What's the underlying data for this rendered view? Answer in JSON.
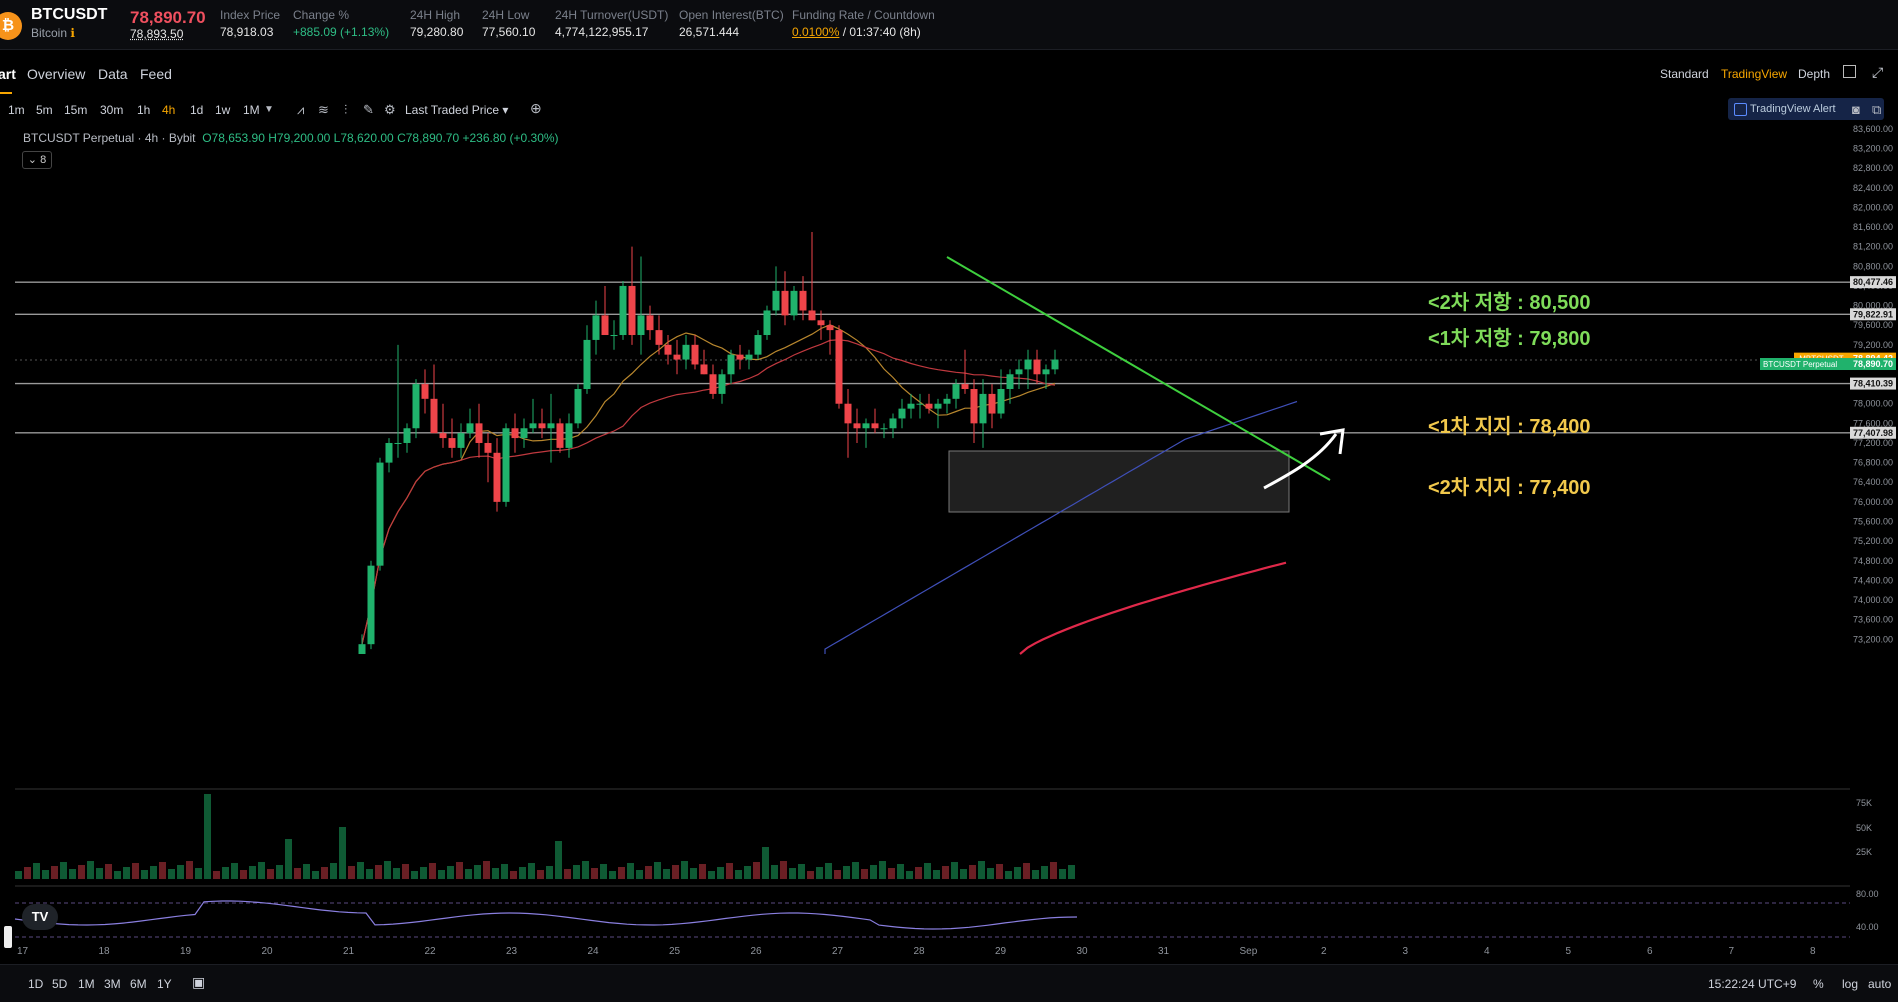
{
  "header": {
    "symbol": "BTCUSDT",
    "name": "Bitcoin",
    "last_price": "78,890.70",
    "mark_price": "78,893.50",
    "stats": [
      {
        "label": "Index Price",
        "value": "78,918.03"
      },
      {
        "label": "Change %",
        "value": "+885.09 (+1.13%)"
      },
      {
        "label": "24H High",
        "value": "79,280.80"
      },
      {
        "label": "24H Low",
        "value": "77,560.10"
      },
      {
        "label": "24H Turnover(USDT)",
        "value": "4,774,122,955.17"
      },
      {
        "label": "Open Interest(BTC)",
        "value": "26,571.444"
      },
      {
        "label": "Funding Rate / Countdown",
        "rate": "0.0100%",
        "countdown": "/ 01:37:40 (8h)"
      }
    ]
  },
  "tabs": [
    "art",
    "Overview",
    "Data",
    "Feed"
  ],
  "view_tabs": [
    "Standard",
    "TradingView",
    "Depth"
  ],
  "timeframes": [
    "1m",
    "5m",
    "15m",
    "30m",
    "1h",
    "4h",
    "1d",
    "1w",
    "1M"
  ],
  "active_timeframe": "4h",
  "price_source": "Last Traded Price",
  "tv_alert": "TradingView Alert",
  "legend": {
    "title": "BTCUSDT Perpetual · 4h · Bybit",
    "o": "O78,653.90",
    "h": "H79,200.00",
    "l": "L78,620.00",
    "c": "C78,890.70",
    "chg": "+236.80 (+0.30%)",
    "indicators_count": "8"
  },
  "annotations": [
    {
      "text": "<2차 저항 : 80,500",
      "color": "#7fdc5a"
    },
    {
      "text": "<1차 저항 : 79,800",
      "color": "#7fdc5a"
    },
    {
      "text": "<1차 지지 : 78,400",
      "color": "#f2c94c"
    },
    {
      "text": "<2차 지지 : 77,400",
      "color": "#f2c94c"
    }
  ],
  "tags": [
    {
      "text": ".MBTCUSDT",
      "value": "78,894.42"
    },
    {
      "text": "BTCUSDT Perpetual",
      "value": "78,890.70"
    }
  ],
  "bottom_ranges": [
    "1D",
    "5D",
    "1M",
    "3M",
    "6M",
    "1Y"
  ],
  "bottom_right": {
    "time": "15:22:24 UTC+9",
    "pct": "%",
    "log": "log",
    "auto": "auto"
  },
  "chart_data": {
    "type": "candlestick",
    "y_range": [
      72900,
      83700
    ],
    "price_ticks": [
      "83,600.00",
      "83,200.00",
      "82,800.00",
      "82,400.00",
      "82,000.00",
      "81,600.00",
      "81,200.00",
      "80,800.00",
      "80,400.00",
      "80,000.00",
      "79,600.00",
      "79,200.00",
      "78,800.00",
      "78,400.00",
      "78,000.00",
      "77,600.00",
      "77,200.00",
      "76,800.00",
      "76,400.00",
      "76,000.00",
      "75,600.00",
      "75,200.00",
      "74,800.00",
      "74,400.00",
      "74,000.00",
      "73,600.00",
      "73,200.00"
    ],
    "date_ticks": [
      "17",
      "18",
      "19",
      "20",
      "21",
      "22",
      "23",
      "24",
      "25",
      "26",
      "27",
      "28",
      "29",
      "30",
      "31",
      "Sep",
      "2",
      "3",
      "4",
      "5",
      "6",
      "7",
      "8"
    ],
    "hlines": [
      {
        "price": 80477.46,
        "label": "80,477.46"
      },
      {
        "price": 79822.91,
        "label": "79,822.91"
      },
      {
        "price": 78410.39,
        "label": "78,410.39"
      },
      {
        "price": 77407.98,
        "label": "77,407.98"
      }
    ],
    "volume_ticks": [
      "75K",
      "50K",
      "25K"
    ],
    "rsi_ticks": [
      "80.00",
      "40.00"
    ],
    "candles": [
      [
        72900,
        73300,
        72900,
        73100
      ],
      [
        73100,
        74800,
        73000,
        74700
      ],
      [
        74700,
        76900,
        74600,
        76800
      ],
      [
        76800,
        77300,
        76600,
        77200
      ],
      [
        77200,
        79200,
        76900,
        77200
      ],
      [
        77200,
        77600,
        77000,
        77500
      ],
      [
        77500,
        78500,
        77300,
        78400
      ],
      [
        78400,
        78700,
        77800,
        78100
      ],
      [
        78100,
        78800,
        77400,
        77400
      ],
      [
        77400,
        78000,
        77100,
        77300
      ],
      [
        77300,
        77700,
        76900,
        77100
      ],
      [
        77100,
        77600,
        76900,
        77400
      ],
      [
        77400,
        77900,
        77300,
        77600
      ],
      [
        77600,
        78000,
        76900,
        77200
      ],
      [
        77200,
        77400,
        76400,
        77000
      ],
      [
        77000,
        77300,
        75800,
        76000
      ],
      [
        76000,
        77600,
        75900,
        77500
      ],
      [
        77500,
        77800,
        77000,
        77300
      ],
      [
        77300,
        77700,
        77100,
        77500
      ],
      [
        77500,
        78100,
        77400,
        77600
      ],
      [
        77600,
        77900,
        77300,
        77500
      ],
      [
        77500,
        78200,
        76800,
        77600
      ],
      [
        77600,
        77700,
        77000,
        77100
      ],
      [
        77100,
        77800,
        76900,
        77600
      ],
      [
        77600,
        78400,
        77500,
        78300
      ],
      [
        78300,
        79600,
        78200,
        79300
      ],
      [
        79300,
        80100,
        79000,
        79800
      ],
      [
        79800,
        80400,
        79400,
        79400
      ],
      [
        79400,
        79700,
        79100,
        79400
      ],
      [
        79400,
        80500,
        79300,
        80400
      ],
      [
        80400,
        81200,
        79200,
        79400
      ],
      [
        79400,
        81000,
        79000,
        79800
      ],
      [
        79800,
        80000,
        79300,
        79500
      ],
      [
        79500,
        79800,
        79000,
        79200
      ],
      [
        79200,
        79400,
        78800,
        79000
      ],
      [
        79000,
        79300,
        78600,
        78900
      ],
      [
        78900,
        79400,
        78700,
        79200
      ],
      [
        79200,
        79400,
        78700,
        78800
      ],
      [
        78800,
        79100,
        78600,
        78600
      ],
      [
        78600,
        78800,
        78100,
        78200
      ],
      [
        78200,
        78700,
        78000,
        78600
      ],
      [
        78600,
        79100,
        78400,
        79000
      ],
      [
        79000,
        79200,
        78700,
        78900
      ],
      [
        78900,
        79100,
        78700,
        79000
      ],
      [
        79000,
        79500,
        78900,
        79400
      ],
      [
        79400,
        80000,
        79300,
        79900
      ],
      [
        79900,
        80800,
        79800,
        80300
      ],
      [
        80300,
        80700,
        79600,
        79800
      ],
      [
        79800,
        80400,
        79700,
        80300
      ],
      [
        80300,
        80600,
        79700,
        79900
      ],
      [
        79900,
        81500,
        79700,
        79700
      ],
      [
        79700,
        79900,
        79300,
        79600
      ],
      [
        79600,
        79700,
        79000,
        79500
      ],
      [
        79500,
        79600,
        77900,
        78000
      ],
      [
        78000,
        78300,
        76900,
        77600
      ],
      [
        77600,
        77900,
        77200,
        77500
      ],
      [
        77500,
        77700,
        77100,
        77600
      ],
      [
        77600,
        77900,
        77400,
        77500
      ],
      [
        77500,
        77600,
        77300,
        77500
      ],
      [
        77500,
        77800,
        77300,
        77700
      ],
      [
        77700,
        78100,
        77500,
        77900
      ],
      [
        77900,
        78200,
        77700,
        78000
      ],
      [
        78000,
        78200,
        77700,
        78000
      ],
      [
        78000,
        78200,
        77800,
        77900
      ],
      [
        77900,
        78100,
        77500,
        78000
      ],
      [
        78000,
        78200,
        77800,
        78100
      ],
      [
        78100,
        78500,
        77900,
        78400
      ],
      [
        78400,
        79100,
        78200,
        78300
      ],
      [
        78300,
        78500,
        77200,
        77600
      ],
      [
        77600,
        78500,
        77100,
        78200
      ],
      [
        78200,
        78400,
        77500,
        77800
      ],
      [
        77800,
        78700,
        77700,
        78300
      ],
      [
        78300,
        78700,
        78000,
        78600
      ],
      [
        78600,
        78900,
        78300,
        78700
      ],
      [
        78700,
        79100,
        78300,
        78900
      ],
      [
        78900,
        79100,
        78400,
        78600
      ],
      [
        78600,
        78800,
        78300,
        78700
      ],
      [
        78700,
        79100,
        78600,
        78900
      ]
    ]
  }
}
